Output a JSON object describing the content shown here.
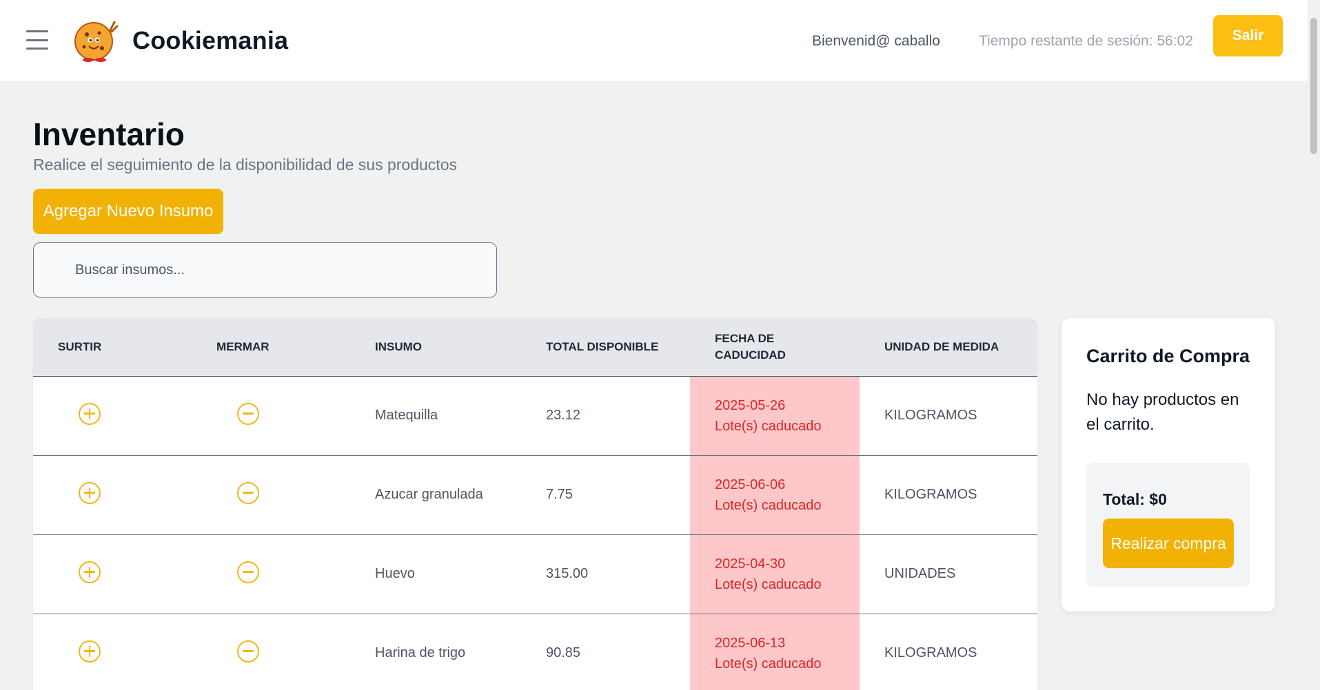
{
  "header": {
    "brand": "Cookiemania",
    "welcome": "Bienvenid@ caballo",
    "session": "Tiempo restante de sesión: 56:02",
    "logout_label": "Salir"
  },
  "page": {
    "title": "Inventario",
    "subtitle": "Realice el seguimiento de la disponibilidad de sus productos",
    "add_button": "Agregar Nuevo Insumo",
    "search_placeholder": "Buscar insumos..."
  },
  "table": {
    "headers": [
      "SURTIR",
      "MERMAR",
      "INSUMO",
      "TOTAL DISPONIBLE",
      "FECHA DE CADUCIDAD",
      "UNIDAD DE MEDIDA"
    ],
    "rows": [
      {
        "insumo": "Matequilla",
        "total": "23.12",
        "fecha": "2025-05-26",
        "estado": "Lote(s) caducado",
        "unidad": "KILOGRAMOS"
      },
      {
        "insumo": "Azucar granulada",
        "total": "7.75",
        "fecha": "2025-06-06",
        "estado": "Lote(s) caducado",
        "unidad": "KILOGRAMOS"
      },
      {
        "insumo": "Huevo",
        "total": "315.00",
        "fecha": "2025-04-30",
        "estado": "Lote(s) caducado",
        "unidad": "UNIDADES"
      },
      {
        "insumo": "Harina de trigo",
        "total": "90.85",
        "fecha": "2025-06-13",
        "estado": "Lote(s) caducado",
        "unidad": "KILOGRAMOS"
      }
    ]
  },
  "cart": {
    "title": "Carrito de Compra",
    "empty": "No hay productos en el carrito.",
    "total": "Total: $0",
    "buy_button": "Realizar compra"
  },
  "icons": {
    "menu": "hamburger-menu-icon",
    "surtir": "plus-circle-icon",
    "mermar": "minus-circle-icon"
  },
  "colors": {
    "accent": "#f2b205",
    "expired_bg": "#fec8ca",
    "expired_text": "#dc2626"
  }
}
